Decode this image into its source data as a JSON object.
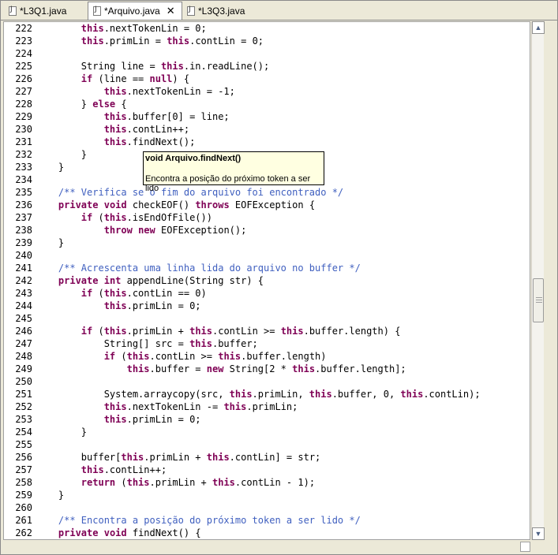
{
  "tabs": [
    {
      "label": "*L3Q1.java",
      "active": false
    },
    {
      "label": "*Arquivo.java",
      "active": true
    },
    {
      "label": "*L3Q3.java",
      "active": false
    }
  ],
  "tab_close_glyph": "✕",
  "scrollbar": {
    "up_glyph": "▲",
    "down_glyph": "▼",
    "position_fraction": 0.5
  },
  "tooltip": {
    "signature": "void Arquivo.findNext()",
    "description": "Encontra a posição do próximo token a ser lido"
  },
  "colors": {
    "keyword": "#7f0055",
    "comment": "#3f5fbf",
    "tooltip_bg": "#ffffe1"
  },
  "code": [
    {
      "n": "222",
      "t": [
        [
          "",
          "        "
        ],
        [
          "kw",
          "this"
        ],
        [
          "",
          ".nextTokenLin = 0;"
        ]
      ]
    },
    {
      "n": "223",
      "t": [
        [
          "",
          "        "
        ],
        [
          "kw",
          "this"
        ],
        [
          "",
          ".primLin = "
        ],
        [
          "kw",
          "this"
        ],
        [
          "",
          ".contLin = 0;"
        ]
      ]
    },
    {
      "n": "224",
      "t": [
        [
          "",
          ""
        ]
      ]
    },
    {
      "n": "225",
      "t": [
        [
          "",
          "        String line = "
        ],
        [
          "kw",
          "this"
        ],
        [
          "",
          ".in.readLine();"
        ]
      ]
    },
    {
      "n": "226",
      "t": [
        [
          "",
          "        "
        ],
        [
          "kw",
          "if"
        ],
        [
          "",
          " (line == "
        ],
        [
          "kw",
          "null"
        ],
        [
          "",
          ") {"
        ]
      ]
    },
    {
      "n": "227",
      "t": [
        [
          "",
          "            "
        ],
        [
          "kw",
          "this"
        ],
        [
          "",
          ".nextTokenLin = -1;"
        ]
      ]
    },
    {
      "n": "228",
      "t": [
        [
          "",
          "        } "
        ],
        [
          "kw",
          "else"
        ],
        [
          "",
          " {"
        ]
      ]
    },
    {
      "n": "229",
      "t": [
        [
          "",
          "            "
        ],
        [
          "kw",
          "this"
        ],
        [
          "",
          ".buffer[0] = line;"
        ]
      ]
    },
    {
      "n": "230",
      "t": [
        [
          "",
          "            "
        ],
        [
          "kw",
          "this"
        ],
        [
          "",
          ".contLin++;"
        ]
      ]
    },
    {
      "n": "231",
      "t": [
        [
          "",
          "            "
        ],
        [
          "kw",
          "this"
        ],
        [
          "",
          ".findNext();"
        ]
      ]
    },
    {
      "n": "232",
      "t": [
        [
          "",
          "        }"
        ]
      ]
    },
    {
      "n": "233",
      "t": [
        [
          "",
          "    }"
        ]
      ]
    },
    {
      "n": "234",
      "t": [
        [
          "",
          ""
        ]
      ]
    },
    {
      "n": "235",
      "t": [
        [
          "",
          "    "
        ],
        [
          "cm",
          "/** Verifica se o fim do arquivo foi encontrado */"
        ]
      ]
    },
    {
      "n": "236",
      "t": [
        [
          "",
          "    "
        ],
        [
          "kw",
          "private"
        ],
        [
          "",
          " "
        ],
        [
          "kw",
          "void"
        ],
        [
          "",
          " checkEOF() "
        ],
        [
          "kw",
          "throws"
        ],
        [
          "",
          " EOFException {"
        ]
      ]
    },
    {
      "n": "237",
      "t": [
        [
          "",
          "        "
        ],
        [
          "kw",
          "if"
        ],
        [
          "",
          " ("
        ],
        [
          "kw",
          "this"
        ],
        [
          "",
          ".isEndOfFile())"
        ]
      ]
    },
    {
      "n": "238",
      "t": [
        [
          "",
          "            "
        ],
        [
          "kw",
          "throw"
        ],
        [
          "",
          " "
        ],
        [
          "kw",
          "new"
        ],
        [
          "",
          " EOFException();"
        ]
      ]
    },
    {
      "n": "239",
      "t": [
        [
          "",
          "    }"
        ]
      ]
    },
    {
      "n": "240",
      "t": [
        [
          "",
          ""
        ]
      ]
    },
    {
      "n": "241",
      "t": [
        [
          "",
          "    "
        ],
        [
          "cm",
          "/** Acrescenta uma linha lida do arquivo no buffer */"
        ]
      ]
    },
    {
      "n": "242",
      "t": [
        [
          "",
          "    "
        ],
        [
          "kw",
          "private"
        ],
        [
          "",
          " "
        ],
        [
          "kw",
          "int"
        ],
        [
          "",
          " appendLine(String str) {"
        ]
      ]
    },
    {
      "n": "243",
      "t": [
        [
          "",
          "        "
        ],
        [
          "kw",
          "if"
        ],
        [
          "",
          " ("
        ],
        [
          "kw",
          "this"
        ],
        [
          "",
          ".contLin == 0)"
        ]
      ]
    },
    {
      "n": "244",
      "t": [
        [
          "",
          "            "
        ],
        [
          "kw",
          "this"
        ],
        [
          "",
          ".primLin = 0;"
        ]
      ]
    },
    {
      "n": "245",
      "t": [
        [
          "",
          ""
        ]
      ]
    },
    {
      "n": "246",
      "t": [
        [
          "",
          "        "
        ],
        [
          "kw",
          "if"
        ],
        [
          "",
          " ("
        ],
        [
          "kw",
          "this"
        ],
        [
          "",
          ".primLin + "
        ],
        [
          "kw",
          "this"
        ],
        [
          "",
          ".contLin >= "
        ],
        [
          "kw",
          "this"
        ],
        [
          "",
          ".buffer.length) {"
        ]
      ]
    },
    {
      "n": "247",
      "t": [
        [
          "",
          "            String[] src = "
        ],
        [
          "kw",
          "this"
        ],
        [
          "",
          ".buffer;"
        ]
      ]
    },
    {
      "n": "248",
      "t": [
        [
          "",
          "            "
        ],
        [
          "kw",
          "if"
        ],
        [
          "",
          " ("
        ],
        [
          "kw",
          "this"
        ],
        [
          "",
          ".contLin >= "
        ],
        [
          "kw",
          "this"
        ],
        [
          "",
          ".buffer.length)"
        ]
      ]
    },
    {
      "n": "249",
      "t": [
        [
          "",
          "                "
        ],
        [
          "kw",
          "this"
        ],
        [
          "",
          ".buffer = "
        ],
        [
          "kw",
          "new"
        ],
        [
          "",
          " String[2 * "
        ],
        [
          "kw",
          "this"
        ],
        [
          "",
          ".buffer.length];"
        ]
      ]
    },
    {
      "n": "250",
      "t": [
        [
          "",
          ""
        ]
      ]
    },
    {
      "n": "251",
      "t": [
        [
          "",
          "            System.arraycopy(src, "
        ],
        [
          "kw",
          "this"
        ],
        [
          "",
          ".primLin, "
        ],
        [
          "kw",
          "this"
        ],
        [
          "",
          ".buffer, 0, "
        ],
        [
          "kw",
          "this"
        ],
        [
          "",
          ".contLin);"
        ]
      ]
    },
    {
      "n": "252",
      "t": [
        [
          "",
          "            "
        ],
        [
          "kw",
          "this"
        ],
        [
          "",
          ".nextTokenLin -= "
        ],
        [
          "kw",
          "this"
        ],
        [
          "",
          ".primLin;"
        ]
      ]
    },
    {
      "n": "253",
      "t": [
        [
          "",
          "            "
        ],
        [
          "kw",
          "this"
        ],
        [
          "",
          ".primLin = 0;"
        ]
      ]
    },
    {
      "n": "254",
      "t": [
        [
          "",
          "        }"
        ]
      ]
    },
    {
      "n": "255",
      "t": [
        [
          "",
          ""
        ]
      ]
    },
    {
      "n": "256",
      "t": [
        [
          "",
          "        buffer["
        ],
        [
          "kw",
          "this"
        ],
        [
          "",
          ".primLin + "
        ],
        [
          "kw",
          "this"
        ],
        [
          "",
          ".contLin] = str;"
        ]
      ]
    },
    {
      "n": "257",
      "t": [
        [
          "",
          "        "
        ],
        [
          "kw",
          "this"
        ],
        [
          "",
          ".contLin++;"
        ]
      ]
    },
    {
      "n": "258",
      "t": [
        [
          "",
          "        "
        ],
        [
          "kw",
          "return"
        ],
        [
          "",
          " ("
        ],
        [
          "kw",
          "this"
        ],
        [
          "",
          ".primLin + "
        ],
        [
          "kw",
          "this"
        ],
        [
          "",
          ".contLin - 1);"
        ]
      ]
    },
    {
      "n": "259",
      "t": [
        [
          "",
          "    }"
        ]
      ]
    },
    {
      "n": "260",
      "t": [
        [
          "",
          ""
        ]
      ]
    },
    {
      "n": "261",
      "t": [
        [
          "",
          "    "
        ],
        [
          "cm",
          "/** Encontra a posição do próximo token a ser lido */"
        ]
      ]
    },
    {
      "n": "262",
      "t": [
        [
          "",
          "    "
        ],
        [
          "kw",
          "private"
        ],
        [
          "",
          " "
        ],
        [
          "kw",
          "void"
        ],
        [
          "",
          " findNext() {"
        ]
      ]
    }
  ]
}
